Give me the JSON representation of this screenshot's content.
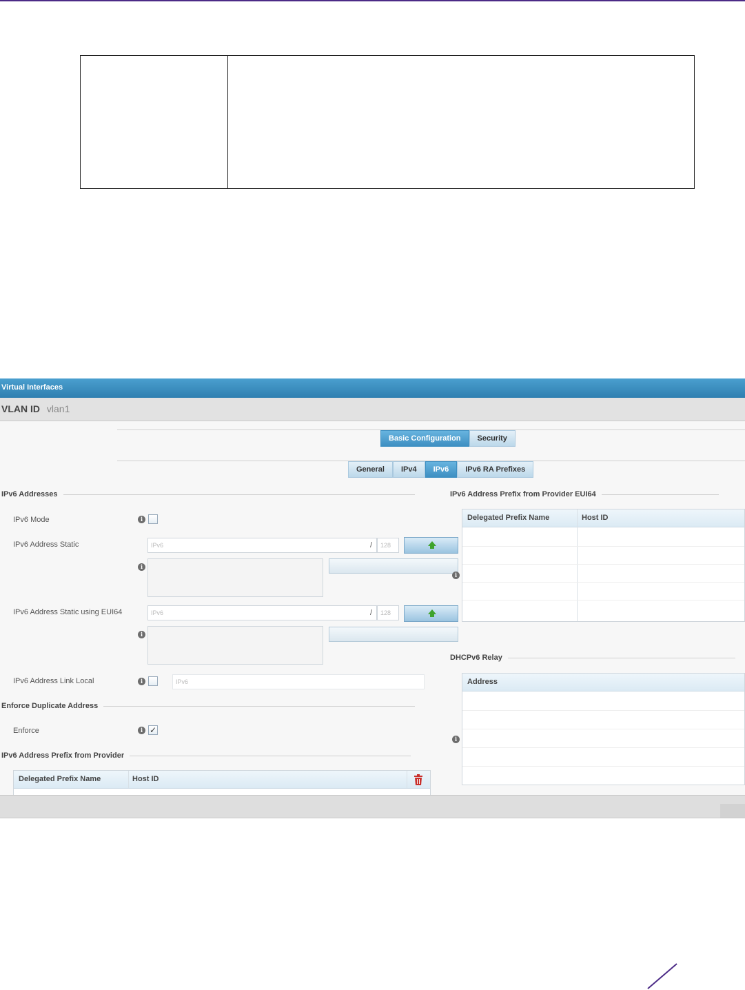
{
  "window": {
    "title": "Virtual Interfaces",
    "vlan_label": "VLAN ID",
    "vlan_value": "vlan1"
  },
  "tabs_primary": [
    {
      "label": "Basic Configuration",
      "active": true
    },
    {
      "label": "Security",
      "active": false
    }
  ],
  "tabs_secondary": [
    {
      "label": "General",
      "active": false
    },
    {
      "label": "IPv4",
      "active": false
    },
    {
      "label": "IPv6",
      "active": true
    },
    {
      "label": "IPv6 RA Prefixes",
      "active": false
    }
  ],
  "left": {
    "ipv6_addresses_title": "IPv6 Addresses",
    "ipv6_mode_label": "IPv6 Mode",
    "ipv6_mode_checked": false,
    "static_label": "IPv6 Address Static",
    "static_placeholder": "IPv6",
    "static_prefix_placeholder": "128",
    "eui64_label": "IPv6 Address Static using EUI64",
    "eui64_placeholder": "IPv6",
    "eui64_prefix_placeholder": "128",
    "link_local_label": "IPv6 Address Link Local",
    "link_local_checked": false,
    "link_local_placeholder": "IPv6",
    "enforce_title": "Enforce Duplicate Address",
    "enforce_label": "Enforce",
    "enforce_checked": true,
    "prefix_provider_title": "IPv6 Address Prefix from Provider",
    "prefix_provider_columns": [
      "Delegated Prefix Name",
      "Host ID"
    ]
  },
  "right": {
    "eui64_title": "IPv6 Address Prefix from Provider EUI64",
    "eui64_columns": [
      "Delegated Prefix Name",
      "Host ID"
    ],
    "dhcp_title": "DHCPv6 Relay",
    "dhcp_columns": [
      "Address"
    ]
  },
  "icons": {
    "info": "info-icon",
    "add": "green-up-arrow-icon",
    "delete": "trash-icon"
  },
  "colors": {
    "title_bar": "#3d8fc2",
    "active_tab": "#3d8fc2",
    "brand_rule": "#4b2a86",
    "delete_icon": "#c9302c",
    "add_arrow": "#3fa32c"
  }
}
